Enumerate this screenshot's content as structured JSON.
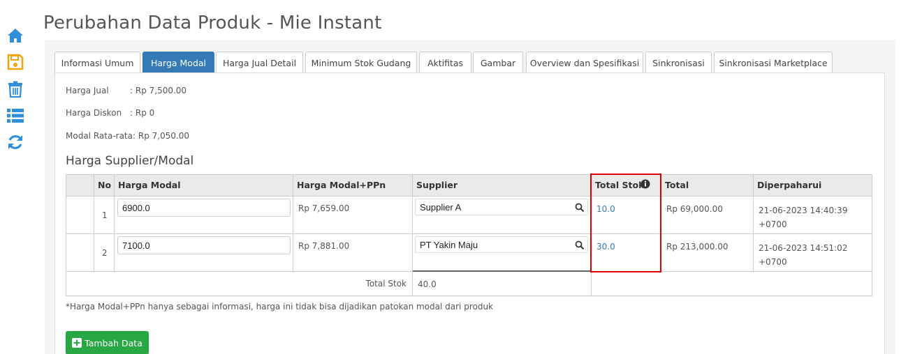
{
  "page": {
    "title": "Perubahan Data Produk - Mie Instant"
  },
  "sidebar": {
    "icons": [
      "home-icon",
      "save-icon",
      "trash-icon",
      "list-icon",
      "sync-icon"
    ],
    "color": "#2f8fd8",
    "save_color": "#f0a30a"
  },
  "tabs": [
    {
      "label": "Informasi Umum"
    },
    {
      "label": "Harga Modal"
    },
    {
      "label": "Harga Jual Detail"
    },
    {
      "label": "Minimum Stok Gudang"
    },
    {
      "label": "Aktifitas"
    },
    {
      "label": "Gambar"
    },
    {
      "label": "Overview dan Spesifikasi"
    },
    {
      "label": "Sinkronisasi"
    },
    {
      "label": "Sinkronisasi Marketplace"
    }
  ],
  "active_tab": "Harga Modal",
  "info": {
    "harga_jual_label": "Harga Jual",
    "harga_jual_value": ": Rp 7,500.00",
    "harga_diskon_label": "Harga Diskon",
    "harga_diskon_value": ": Rp 0",
    "modal_label": "Modal Rata-rata:",
    "modal_value": "Rp 7,050.00"
  },
  "section_title": "Harga Supplier/Modal",
  "table": {
    "headers": {
      "no": "No",
      "harga_modal": "Harga Modal",
      "harga_modal_ppn": "Harga Modal+PPn",
      "supplier": "Supplier",
      "total_stok": "Total Stok",
      "total": "Total",
      "diperbaharui": "Diperpaharui"
    },
    "rows": [
      {
        "no": "1",
        "harga_modal": "6900.0",
        "harga_modal_ppn": "Rp 7,659.00",
        "supplier": "Supplier A",
        "total_stok": "10.0",
        "total": "Rp 69,000.00",
        "updated_date": "21-06-2023 14:40:39",
        "updated_tz": "+0700"
      },
      {
        "no": "2",
        "harga_modal": "7100.0",
        "harga_modal_ppn": "Rp 7,881.00",
        "supplier": "PT Yakin Maju",
        "total_stok": "30.0",
        "total": "Rp 213,000.00",
        "updated_date": "21-06-2023 14:51:02",
        "updated_tz": "+0700"
      }
    ],
    "footer_label": "Total Stok",
    "footer_value": "40.0"
  },
  "footnote": "*Harga Modal+PPn hanya sebagai informasi, harga ini tidak bisa dijadikan patokan modal dari produk",
  "add_button": {
    "label": "Tambah Data",
    "color": "#28a745"
  },
  "highlight_color": "#e00000"
}
